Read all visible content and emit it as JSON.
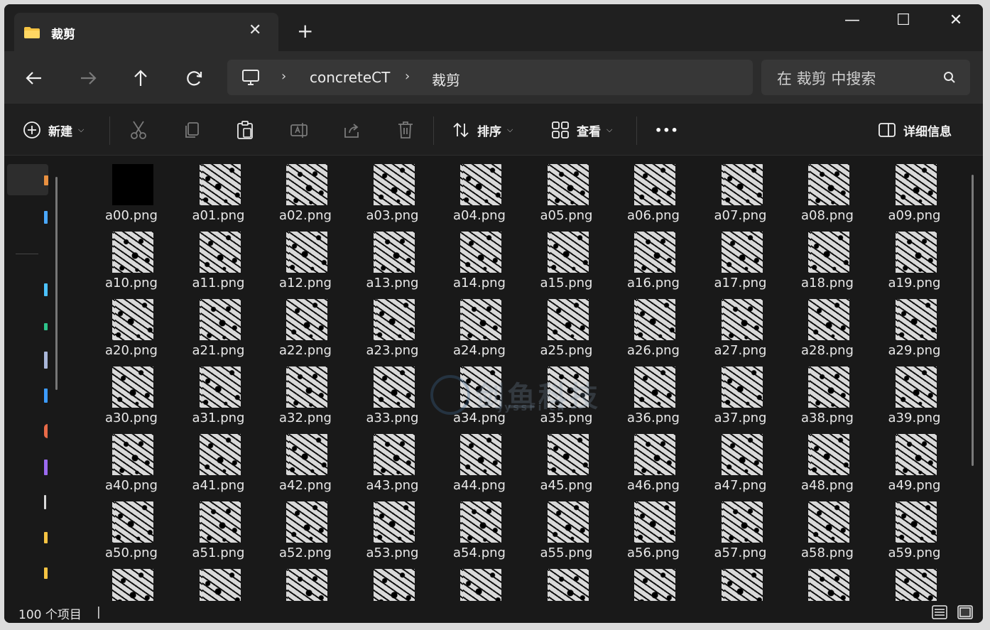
{
  "window": {
    "tab_title": "裁剪",
    "close_tab_glyph": "✕",
    "new_tab_glyph": "+",
    "minimize_glyph": "—",
    "maximize_glyph": "☐",
    "close_glyph": "✕"
  },
  "address": {
    "crumbs": [
      "concreteCT",
      "裁剪"
    ],
    "separator": "›",
    "search_placeholder": "在 裁剪 中搜索"
  },
  "toolbar": {
    "new_label": "新建",
    "sort_label": "排序",
    "view_label": "查看",
    "more_glyph": "•••",
    "details_label": "详细信息"
  },
  "files": [
    "a00.png",
    "a01.png",
    "a02.png",
    "a03.png",
    "a04.png",
    "a05.png",
    "a06.png",
    "a07.png",
    "a08.png",
    "a09.png",
    "a10.png",
    "a11.png",
    "a12.png",
    "a13.png",
    "a14.png",
    "a15.png",
    "a16.png",
    "a17.png",
    "a18.png",
    "a19.png",
    "a20.png",
    "a21.png",
    "a22.png",
    "a23.png",
    "a24.png",
    "a25.png",
    "a26.png",
    "a27.png",
    "a28.png",
    "a29.png",
    "a30.png",
    "a31.png",
    "a32.png",
    "a33.png",
    "a34.png",
    "a35.png",
    "a36.png",
    "a37.png",
    "a38.png",
    "a39.png",
    "a40.png",
    "a41.png",
    "a42.png",
    "a43.png",
    "a44.png",
    "a45.png",
    "a46.png",
    "a47.png",
    "a48.png",
    "a49.png",
    "a50.png",
    "a51.png",
    "a52.png",
    "a53.png",
    "a54.png",
    "a55.png",
    "a56.png",
    "a57.png",
    "a58.png",
    "a59.png",
    "",
    "",
    "",
    "",
    "",
    "",
    "",
    "",
    "",
    ""
  ],
  "status": {
    "item_count": "100 个项目",
    "cursor": "|"
  },
  "watermark": {
    "text": "剑鱼科技",
    "sub": "JyssFi  ch"
  },
  "colors": {
    "accent_blue": "#4cc2ff",
    "folder_yellow": "#f5c342"
  }
}
